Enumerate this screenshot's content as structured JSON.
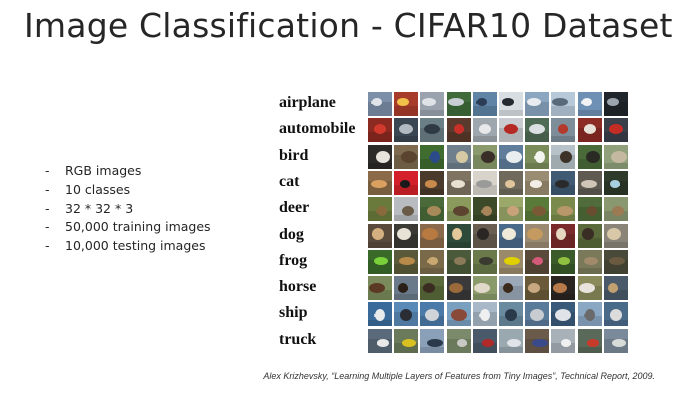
{
  "title": "Image Classification - CIFAR10 Dataset",
  "bullets": [
    {
      "dash": "-",
      "text": "RGB images"
    },
    {
      "dash": "-",
      "text": "10 classes"
    },
    {
      "dash": "-",
      "text": "32 * 32 * 3"
    },
    {
      "dash": "-",
      "text": "50,000 training images"
    },
    {
      "dash": "-",
      "text": "10,000 testing images"
    }
  ],
  "figure": {
    "classes": [
      {
        "label": "airplane",
        "colors": [
          "#7b8fa8",
          "#a83c2a",
          "#9aa3ad",
          "#3f6b3a",
          "#5f84a6",
          "#d8dde2",
          "#8aa6c0",
          "#b7c9d9",
          "#6f90b5",
          "#20262c"
        ],
        "subjects": [
          "#e0e4ea",
          "#f1c04a",
          "#dfe2e6",
          "#c9ced4",
          "#2c3e55",
          "#252a30",
          "#e8ecf0",
          "#5a6a7a",
          "#f0f2f4",
          "#9ca4ad"
        ]
      },
      {
        "label": "automobile",
        "colors": [
          "#8c2a22",
          "#3a4652",
          "#6b7f86",
          "#5a3a2c",
          "#9fa7ae",
          "#c9ccd0",
          "#4f6a55",
          "#7d8d9a",
          "#8d2b25",
          "#3a3f4a"
        ],
        "subjects": [
          "#d1392c",
          "#b3b9c0",
          "#2f3a44",
          "#c8302a",
          "#e6e8ea",
          "#b52a25",
          "#dcdfe2",
          "#b33a2c",
          "#e6e2d8",
          "#c42c24"
        ]
      },
      {
        "label": "bird",
        "colors": [
          "#2b2a28",
          "#7d6a4f",
          "#3f6c2f",
          "#6f7f8c",
          "#8a9a6c",
          "#5f7c9a",
          "#7a8c5a",
          "#b6c2c8",
          "#4a6a3a",
          "#8fa07a"
        ],
        "subjects": [
          "#e6e2dc",
          "#5a4430",
          "#2b4a8a",
          "#d6c9a3",
          "#3a2f28",
          "#e9edf0",
          "#f2f4ef",
          "#3c3228",
          "#2a2a24",
          "#c4b9a0"
        ]
      },
      {
        "label": "cat",
        "colors": [
          "#8a6a48",
          "#d4202a",
          "#4a3a2c",
          "#7f7462",
          "#d8d4cc",
          "#6f6a5c",
          "#9a8c72",
          "#3f5a72",
          "#5e5a52",
          "#2e3a2a"
        ],
        "subjects": [
          "#d9a060",
          "#1a1a1a",
          "#c88a4a",
          "#e8e0d2",
          "#9a9a98",
          "#e0c49a",
          "#f2ede6",
          "#2a2a2a",
          "#cfc6b8",
          "#a8d0e0"
        ]
      },
      {
        "label": "deer",
        "colors": [
          "#6a7a3c",
          "#b8bcc0",
          "#4a6a3a",
          "#8a9a5c",
          "#3c4a2a",
          "#9aa86a",
          "#5a7a3a",
          "#7a8a4c",
          "#4f6c3a",
          "#8a9870"
        ],
        "subjects": [
          "#8a6a3c",
          "#6a5a48",
          "#a88a5a",
          "#5c4430",
          "#a8845a",
          "#c9a27a",
          "#7a5a36",
          "#b8976a",
          "#6a4c30",
          "#9c7a54"
        ]
      },
      {
        "label": "dog",
        "colors": [
          "#5a4a3c",
          "#3c3a34",
          "#8a6a4a",
          "#2e4a3a",
          "#6a5e50",
          "#4a6a8a",
          "#9a8a72",
          "#7a2a2a",
          "#5a6a3a",
          "#8a8478"
        ],
        "subjects": [
          "#d4b080",
          "#e8e2d6",
          "#b87a40",
          "#e2c89a",
          "#2a2624",
          "#f0ead8",
          "#c49a60",
          "#e6d8c0",
          "#3a2e24",
          "#d8c8a8"
        ]
      },
      {
        "label": "frog",
        "colors": [
          "#3a6a2a",
          "#5a5a3a",
          "#7a6a4a",
          "#4a5a3a",
          "#6a7a4a",
          "#9a8a6a",
          "#5a4a3a",
          "#3a5a2a",
          "#7a7a5a",
          "#4a4a3a"
        ],
        "subjects": [
          "#7ad03a",
          "#b88a4a",
          "#c8a870",
          "#8a7a5a",
          "#3a3a30",
          "#e0d000",
          "#d45a7a",
          "#90c040",
          "#a08a6a",
          "#6a5a40"
        ]
      },
      {
        "label": "horse",
        "colors": [
          "#7a8a5a",
          "#6a7a8a",
          "#5a6a3a",
          "#3a3a3a",
          "#8a9a6a",
          "#9aa8b8",
          "#6a5a3a",
          "#2a2420",
          "#8a8a5a",
          "#4a5a6a"
        ],
        "subjects": [
          "#5a3a24",
          "#2a2018",
          "#3a2c20",
          "#9a6a3a",
          "#e0d8c8",
          "#3a2a1c",
          "#c8a880",
          "#b87a4a",
          "#e8e4dc",
          "#c0a070"
        ]
      },
      {
        "label": "ship",
        "colors": [
          "#3a6a9a",
          "#5a8ab8",
          "#4a7aa8",
          "#7aa0c0",
          "#a8b8c8",
          "#6a8aa0",
          "#5a7a9a",
          "#3a5a7a",
          "#8aa8c4",
          "#4a6a8a"
        ],
        "subjects": [
          "#e8eaec",
          "#2a2e34",
          "#d0d4d8",
          "#8a4a3a",
          "#f0f0f0",
          "#2a3a4a",
          "#c8ccd0",
          "#e0e4e8",
          "#6a6a6a",
          "#dcdcdc"
        ]
      },
      {
        "label": "truck",
        "colors": [
          "#5a6a7a",
          "#6a7a5a",
          "#8aa0b8",
          "#7a8a6a",
          "#4a5a6a",
          "#9aa8b0",
          "#6a5a4a",
          "#a8b0b8",
          "#5a6a5a",
          "#7a8a9a"
        ],
        "subjects": [
          "#e8e8e8",
          "#d8c020",
          "#2a3a4a",
          "#c8c8c4",
          "#b02a2a",
          "#e0e4e8",
          "#3a4a8a",
          "#f0f0f0",
          "#c83a2a",
          "#d8dcd8"
        ]
      }
    ]
  },
  "citation": "Alex Krizhevsky, “Learning Multiple Layers of Features from Tiny Images”, Technical Report, 2009."
}
